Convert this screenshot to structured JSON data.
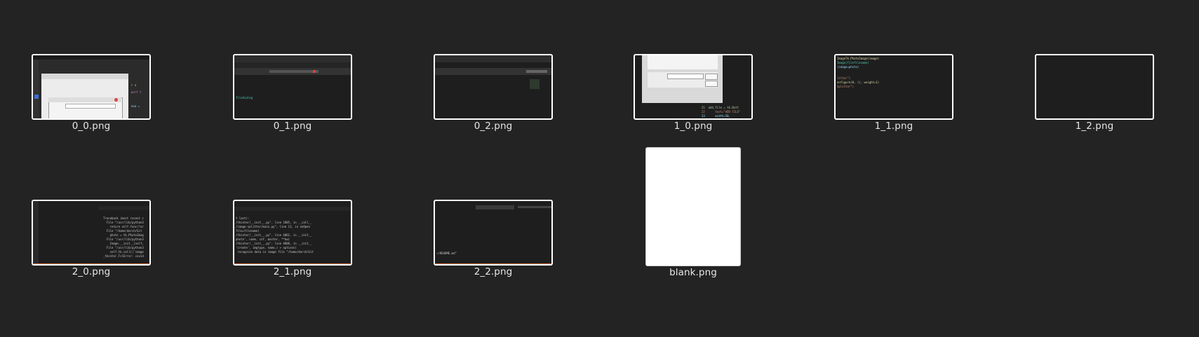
{
  "files": [
    {
      "name": "0_0.png"
    },
    {
      "name": "0_1.png"
    },
    {
      "name": "0_2.png"
    },
    {
      "name": "1_0.png"
    },
    {
      "name": "1_1.png"
    },
    {
      "name": "1_2.png"
    },
    {
      "name": "2_0.png"
    },
    {
      "name": "2_1.png"
    },
    {
      "name": "2_2.png"
    },
    {
      "name": "blank.png"
    }
  ],
  "colors": {
    "background": "#232323",
    "thumb_border": "#ffffff",
    "label": "#e6e6e6",
    "vscode_status": "#e06c3a"
  }
}
